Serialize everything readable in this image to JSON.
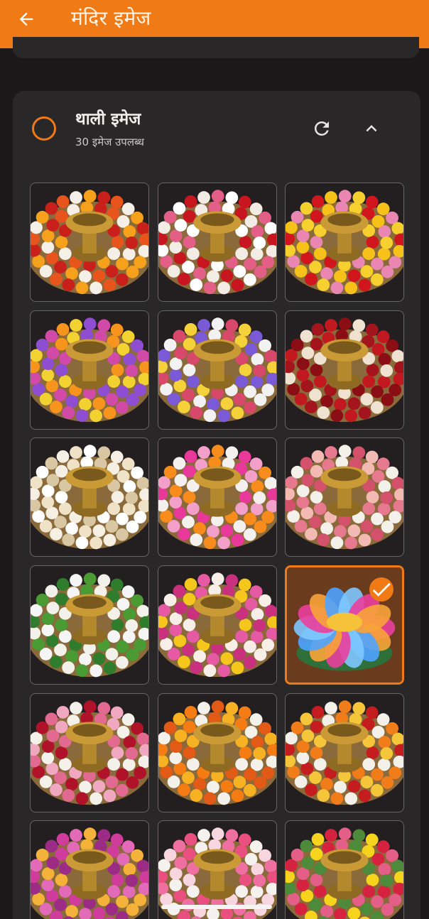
{
  "appbar": {
    "title": "मंदिर इमेज",
    "back_icon": "arrow-left-icon",
    "background": "#ef7a16"
  },
  "section": {
    "title": "थाली इमेज",
    "subtitle": "30 इमेज उपलब्ध",
    "refresh_icon": "refresh-icon",
    "collapse_icon": "chevron-up-icon",
    "radio_color": "#ef7a16"
  },
  "grid": {
    "selected_index": 11,
    "tiles": [
      {
        "flowers": [
          "#e8551c",
          "#f4f0e8",
          "#f6a11c",
          "#c9201b"
        ]
      },
      {
        "flowers": [
          "#c7161f",
          "#f2ece4",
          "#e45f87",
          "#ffffff"
        ]
      },
      {
        "flowers": [
          "#d0151d",
          "#f6c21a",
          "#e987b2",
          "#f5d02f"
        ]
      },
      {
        "flowers": [
          "#f7941d",
          "#f2d230",
          "#8f4ed1",
          "#d24aa8"
        ]
      },
      {
        "flowers": [
          "#f6d23a",
          "#7a5ad6",
          "#f2f2f2",
          "#d8486b"
        ]
      },
      {
        "flowers": [
          "#a3141c",
          "#c1191f",
          "#8b0e14",
          "#f0e2d0"
        ]
      },
      {
        "flowers": [
          "#f5efe4",
          "#efe2c6",
          "#ffffff",
          "#d8c7a2"
        ]
      },
      {
        "flowers": [
          "#e8389a",
          "#f2a0c9",
          "#f78b1c",
          "#f3f0ee"
        ]
      },
      {
        "flowers": [
          "#f2bab3",
          "#e6798e",
          "#f4f0ea",
          "#d4516b"
        ]
      },
      {
        "flowers": [
          "#2f7d2c",
          "#f5f5f5",
          "#4a9b34",
          "#f2f2ea"
        ]
      },
      {
        "flowers": [
          "#f5c61c",
          "#e55aa2",
          "#f7eee8",
          "#c9307d"
        ]
      },
      {
        "flowers": [
          "#ea3f9d",
          "#f8a43a",
          "#4fa3ff",
          "#7ec8ff"
        ]
      },
      {
        "flowers": [
          "#f0a8c0",
          "#f4f0ea",
          "#b0122a",
          "#e2698f"
        ]
      },
      {
        "flowers": [
          "#f57c12",
          "#f4f1ea",
          "#e25a15",
          "#f6b223"
        ]
      },
      {
        "flowers": [
          "#c51c1f",
          "#f3f0ea",
          "#f07c1a",
          "#f5c63a"
        ]
      },
      {
        "flowers": [
          "#d03c9b",
          "#e26ab8",
          "#f5b23a",
          "#9c2b86"
        ]
      },
      {
        "flowers": [
          "#e94f7f",
          "#f4f1ee",
          "#f7d6df",
          "#ef6fa1"
        ]
      },
      {
        "flowers": [
          "#f6d31c",
          "#d5233f",
          "#e45f87",
          "#4d8a3a"
        ]
      }
    ]
  }
}
